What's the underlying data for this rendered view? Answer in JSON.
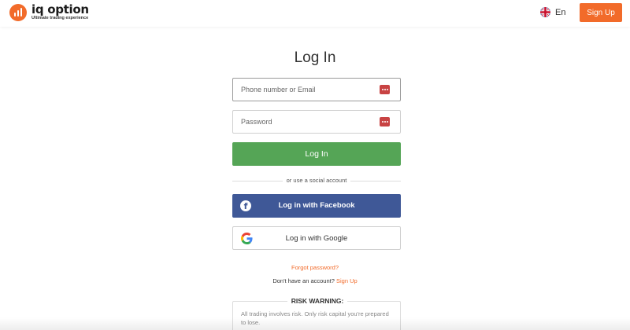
{
  "header": {
    "logo_name": "iq option",
    "logo_tagline": "Ultimate trading experience",
    "language": "En",
    "signup_label": "Sign Up"
  },
  "form": {
    "title": "Log In",
    "identifier_placeholder": "Phone number or Email",
    "password_placeholder": "Password",
    "login_label": "Log In",
    "divider_text": "or use a social account",
    "facebook_label": "Log in with Facebook",
    "google_label": "Log in with Google",
    "forgot_label": "Forgot password?",
    "no_account_text": "Don't have an account?",
    "no_account_link": "Sign Up"
  },
  "risk": {
    "title": "RISK WARNING:",
    "text": "All trading involves risk. Only risk capital you're prepared to lose."
  },
  "colors": {
    "brand_orange": "#f26b2a",
    "login_green": "#55a556",
    "facebook_blue": "#3f5897",
    "field_icon_red": "#c84343"
  }
}
